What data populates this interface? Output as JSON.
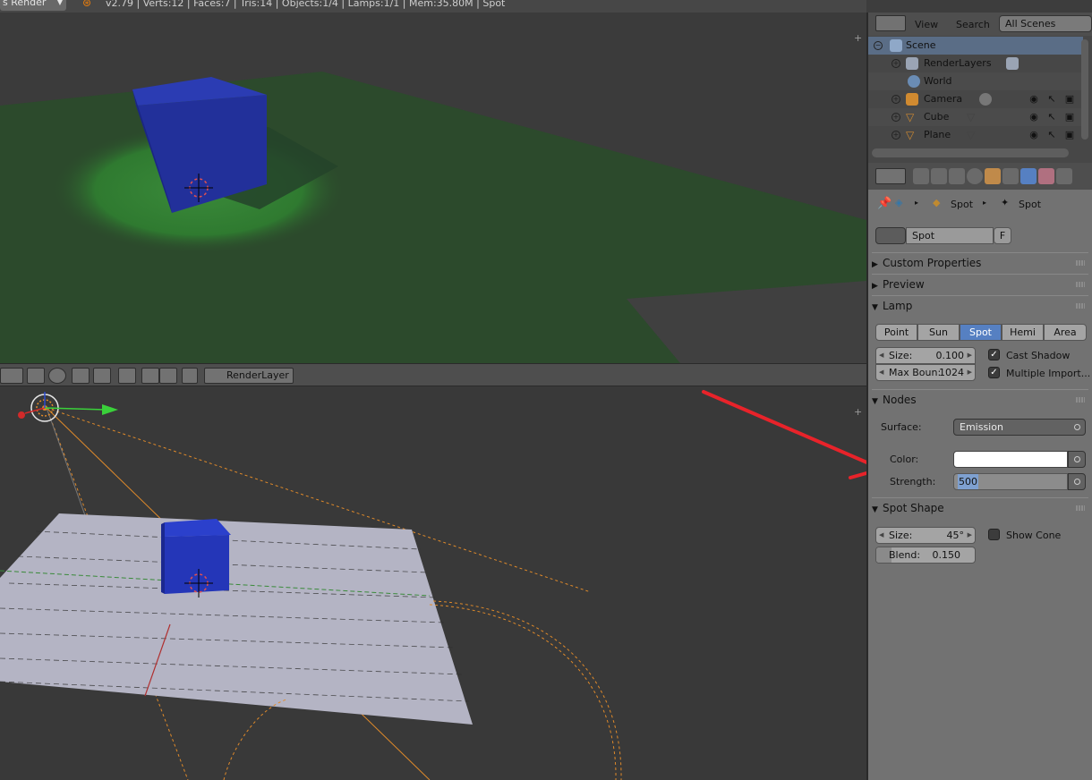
{
  "info_header": {
    "engine": "s Render",
    "stats": "v2.79 | Verts:12 | Faces:7 | Tris:14 | Objects:1/4 | Lamps:1/1 | Mem:35.80M | Spot"
  },
  "viewport_header": {
    "render_layer": "RenderLayer"
  },
  "outliner": {
    "menu": [
      "View",
      "Search"
    ],
    "scene_filter": "All Scenes",
    "rows": [
      {
        "label": "Scene"
      },
      {
        "label": "RenderLayers"
      },
      {
        "label": "World"
      },
      {
        "label": "Camera"
      },
      {
        "label": "Cube"
      },
      {
        "label": "Plane"
      }
    ]
  },
  "properties": {
    "breadcrumb": [
      "Spot",
      "Spot"
    ],
    "datablock_name": "Spot",
    "fake_user": "F",
    "panels": {
      "custom_properties": "Custom Properties",
      "preview": "Preview",
      "lamp": "Lamp",
      "nodes": "Nodes",
      "spot_shape": "Spot Shape"
    },
    "lamp_types": [
      "Point",
      "Sun",
      "Spot",
      "Hemi",
      "Area"
    ],
    "lamp_active": "Spot",
    "lamp_size_label": "Size:",
    "lamp_size_value": "0.100",
    "max_bounces_label": "Max Boun:",
    "max_bounces_value": "1024",
    "cast_shadow": "Cast Shadow",
    "multiple_importance": "Multiple Import...",
    "surface_label": "Surface:",
    "surface_value": "Emission",
    "color_label": "Color:",
    "strength_label": "Strength:",
    "strength_value": "500",
    "spot_size_label": "Size:",
    "spot_size_value": "45°",
    "blend_label": "Blend:",
    "blend_value": "0.150",
    "show_cone": "Show Cone"
  },
  "colors": {
    "accent": "#5680c2",
    "annotation_arrow": "#e8232a",
    "cube": "#1f2fa0",
    "ground_render": "#2c4a2c",
    "ground_solid": "#b4b4c4"
  }
}
